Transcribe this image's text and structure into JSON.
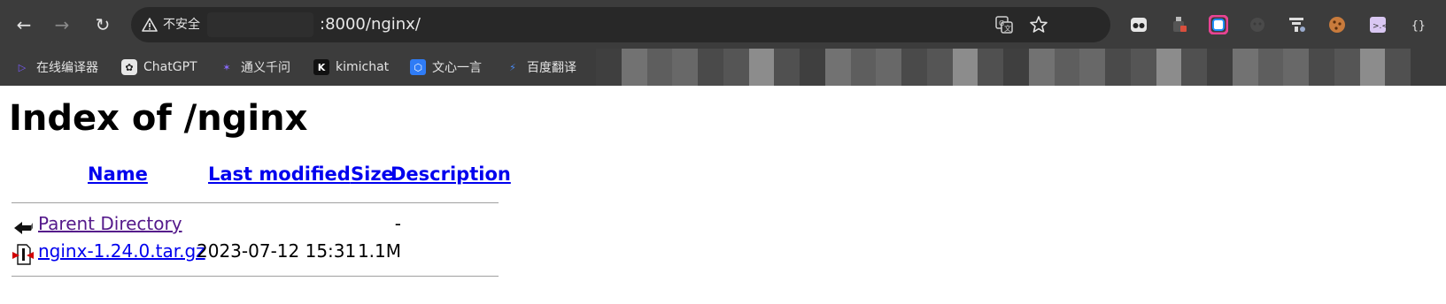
{
  "browser": {
    "security_label": "不安全",
    "url_visible": ":8000/nginx/",
    "icons": [
      "back-icon",
      "forward-icon",
      "reload-icon",
      "translate-icon",
      "star-icon"
    ]
  },
  "extensions": [
    "extension-mask-icon",
    "extension-bottle-icon",
    "extension-color-ring-icon",
    "extension-gray-face-icon",
    "extension-filter-icon",
    "extension-cookie-icon",
    "extension-cat-face-icon",
    "extension-braces-icon"
  ],
  "bookmarks": [
    {
      "label": "在线编译器",
      "icon": "compiler-icon"
    },
    {
      "label": "ChatGPT",
      "icon": "chatgpt-icon"
    },
    {
      "label": "通义千问",
      "icon": "tongyi-icon"
    },
    {
      "label": "kimichat",
      "icon": "kimi-icon"
    },
    {
      "label": "文心一言",
      "icon": "wenxin-icon"
    },
    {
      "label": "百度翻译",
      "icon": "baidu-translate-icon"
    }
  ],
  "page": {
    "title": "Index of /nginx",
    "columns": {
      "name": "Name",
      "modified": "Last modified",
      "size": "Size",
      "description": "Description"
    },
    "rows": [
      {
        "name": "Parent Directory",
        "modified": "",
        "size": "-",
        "description": "",
        "icon": "back-folder-icon"
      },
      {
        "name": "nginx-1.24.0.tar.gz",
        "modified": "2023-07-12 15:31",
        "size": "1.1M",
        "description": "",
        "icon": "archive-file-icon"
      }
    ]
  }
}
